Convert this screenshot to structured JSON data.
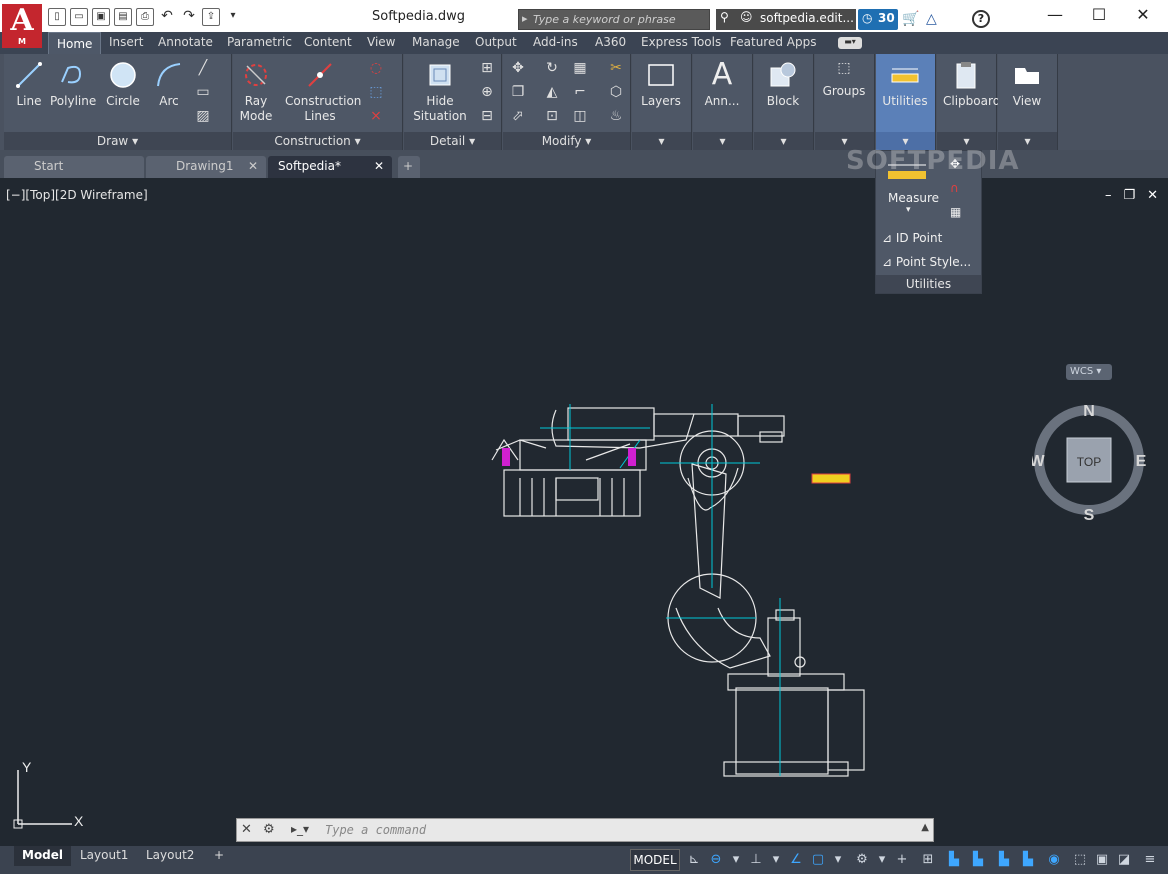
{
  "app": {
    "logo_letter": "A",
    "logo_sub": "M",
    "doc_title": "Softpedia.dwg"
  },
  "search": {
    "placeholder": "Type a keyword or phrase"
  },
  "user": {
    "name": "softpedia.edit...",
    "badge": "30"
  },
  "window": {
    "minimize": "—",
    "maximize": "☐",
    "close": "✕"
  },
  "menu": {
    "tabs": [
      "Home",
      "Insert",
      "Annotate",
      "Parametric",
      "Content",
      "View",
      "Manage",
      "Output",
      "Add-ins",
      "A360",
      "Express Tools",
      "Featured Apps"
    ]
  },
  "ribbon": {
    "draw": {
      "footer": "Draw",
      "line": "Line",
      "polyline": "Polyline",
      "circle": "Circle",
      "arc": "Arc"
    },
    "construction": {
      "footer": "Construction",
      "ray": "Ray",
      "mode": "Mode",
      "construction": "Construction",
      "lines": "Lines"
    },
    "detail": {
      "footer": "Detail",
      "hide": "Hide",
      "situation": "Situation"
    },
    "modify": {
      "footer": "Modify"
    },
    "layers": "Layers",
    "annotation": "Ann...",
    "block": "Block",
    "groups": "Groups",
    "utilities": "Utilities",
    "clipboard": "Clipboard",
    "view": "View"
  },
  "filetabs": {
    "start": "Start",
    "drawing1": "Drawing1",
    "softpedia": "Softpedia*"
  },
  "viewport": {
    "label": "[−][Top][2D Wireframe]",
    "minimize": "–",
    "restore": "❐",
    "close": "✕"
  },
  "flyout": {
    "measure": "Measure",
    "id_point": "ID Point",
    "point_style": "Point Style...",
    "footer": "Utilities"
  },
  "watermark": "SOFTPEDIA",
  "viewcube": {
    "n": "N",
    "s": "S",
    "e": "E",
    "w": "W",
    "top": "TOP",
    "wcs": "WCS"
  },
  "ucs": {
    "x": "X",
    "y": "Y"
  },
  "command": {
    "placeholder": "Type a command"
  },
  "status": {
    "model": "Model",
    "layout1": "Layout1",
    "layout2": "Layout2",
    "model_btn": "MODEL"
  },
  "colors": {
    "accent": "#5b80b8",
    "ribbon": "#4e5766",
    "canvas": "#212830",
    "cyan": "#00c8d8",
    "magenta": "#d020d0"
  }
}
